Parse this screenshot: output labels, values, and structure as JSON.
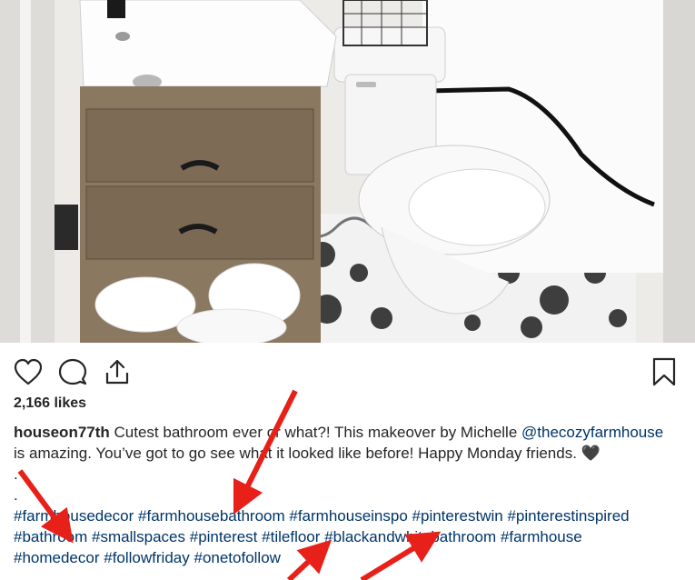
{
  "post": {
    "image_alt": "Bathroom with wood vanity, white toilet and black and white patterned tile floor",
    "likes": "2,166 likes",
    "caption": {
      "username": "houseon77th",
      "text_1": " Cutest bathroom ever or what?! This makeover by Michelle ",
      "mention": "@thecozyfarmhouse",
      "text_2": "is amazing. You’ve got to go see what it looked like before! Happy Monday friends. ",
      "heart": "🖤",
      "dot_1": ".",
      "dot_2": ".",
      "hashtags_line_1": [
        "#farmhousedecor",
        "#farmhousebathroom",
        "#farmhouseinspo",
        "#pinterestwin",
        "#pinterestinspired"
      ],
      "hashtags_line_2": [
        "#bathroom",
        "#smallspaces",
        "#pinterest",
        "#tilefloor",
        "#blackandwhitebathroom",
        "#farmhouse"
      ],
      "hashtags_line_3": [
        "#homedecor",
        "#followfriday",
        "#onetofollow"
      ]
    }
  },
  "actions": {
    "like_icon": "heart-outline-icon",
    "comment_icon": "speech-bubble-icon",
    "share_icon": "share-upload-icon",
    "save_icon": "bookmark-icon"
  },
  "colors": {
    "hashtag": "#003569",
    "text": "#262626",
    "annotation": "#e8201a"
  }
}
